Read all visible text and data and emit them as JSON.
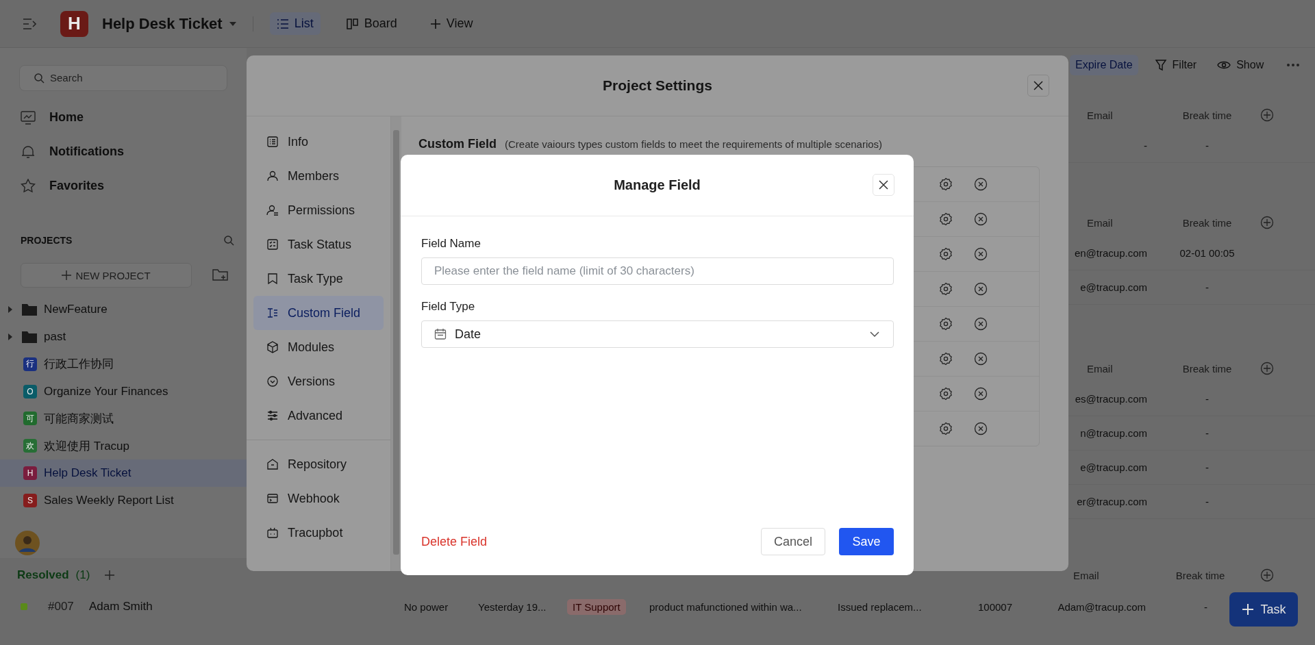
{
  "topbar": {
    "logo_letter": "H",
    "project_title": "Help Desk Ticket",
    "views": [
      {
        "label": "List",
        "selected": true
      },
      {
        "label": "Board",
        "selected": false
      }
    ],
    "add_view": "View"
  },
  "sidebar": {
    "search_placeholder": "Search",
    "nav": [
      "Home",
      "Notifications",
      "Favorites"
    ],
    "projects_heading": "PROJECTS",
    "new_project": "NEW PROJECT",
    "projects": [
      {
        "kind": "folder",
        "name": "NewFeature",
        "selected": false
      },
      {
        "kind": "folder",
        "name": "past",
        "selected": false
      },
      {
        "kind": "project",
        "letter": "行",
        "color": "#1a3080",
        "name": "行政工作协同",
        "selected": false
      },
      {
        "kind": "project",
        "letter": "O",
        "color": "#0a5c68",
        "name": "Organize Your Finances",
        "selected": false
      },
      {
        "kind": "project",
        "letter": "可",
        "color": "#216b2e",
        "name": "可能商家测试",
        "selected": false
      },
      {
        "kind": "project",
        "letter": "欢",
        "color": "#276e35",
        "name": "欢迎使用 Tracup",
        "selected": false
      },
      {
        "kind": "project",
        "letter": "H",
        "color": "#7a1d3e",
        "name": "Help Desk Ticket",
        "selected": true
      },
      {
        "kind": "project",
        "letter": "S",
        "color": "#861d1d",
        "name": "Sales Weekly Report List",
        "selected": false
      }
    ]
  },
  "toolbar": {
    "sort": "Expire Date",
    "filter": "Filter",
    "show": "Show"
  },
  "groups": [
    {
      "columns": [
        "Email",
        "Break time"
      ],
      "rows": [
        {
          "email": "-",
          "break_time": "-"
        }
      ]
    },
    {
      "columns": [
        "Email",
        "Break time"
      ],
      "rows": [
        {
          "email": "en@tracup.com",
          "break_time": "02-01 00:05"
        },
        {
          "email": "e@tracup.com",
          "break_time": "-"
        }
      ]
    },
    {
      "columns": [
        "Email",
        "Break time"
      ],
      "rows": [
        {
          "email": "es@tracup.com",
          "break_time": "-"
        },
        {
          "email": "n@tracup.com",
          "break_time": "-"
        },
        {
          "email": "e@tracup.com",
          "break_time": "-"
        },
        {
          "email": "er@tracup.com",
          "break_time": "-"
        }
      ]
    }
  ],
  "resolved": {
    "name": "Resolved",
    "count": "(1)",
    "columns": [
      "Email",
      "Break time"
    ],
    "row": {
      "color": "#5a8a1a",
      "id": "#007",
      "name": "Adam Smith",
      "problem": "No power",
      "time": "Yesterday 19...",
      "tag": "IT Support",
      "description": "product mafunctioned within wa...",
      "resolution": "Issued replacem...",
      "ticket": "100007",
      "email": "Adam@tracup.com",
      "break_time": "-"
    }
  },
  "add_task": "Task",
  "settings": {
    "title": "Project Settings",
    "nav": [
      {
        "kind": "info",
        "label": "Info",
        "selected": false
      },
      {
        "kind": "members",
        "label": "Members",
        "selected": false
      },
      {
        "kind": "permissions",
        "label": "Permissions",
        "selected": false
      },
      {
        "kind": "status",
        "label": "Task Status",
        "selected": false
      },
      {
        "kind": "type",
        "label": "Task Type",
        "selected": false
      },
      {
        "kind": "custom",
        "label": "Custom Field",
        "selected": true
      },
      {
        "kind": "modules",
        "label": "Modules",
        "selected": false
      },
      {
        "kind": "versions",
        "label": "Versions",
        "selected": false
      },
      {
        "kind": "advanced",
        "label": "Advanced",
        "selected": false
      }
    ],
    "integrations": [
      {
        "kind": "repository",
        "label": "Repository",
        "selected": false
      },
      {
        "kind": "webhook",
        "label": "Webhook",
        "selected": false
      },
      {
        "kind": "bot",
        "label": "Tracupbot",
        "selected": false
      }
    ],
    "section_title": "Custom Field",
    "section_hint": "(Create vaiours types custom fields to meet the requirements of multiple scenarios)"
  },
  "manage_field": {
    "title": "Manage Field",
    "name_label": "Field Name",
    "name_placeholder": "Please enter the field name (limit of 30 characters)",
    "type_label": "Field Type",
    "type_value": "Date",
    "delete": "Delete Field",
    "cancel": "Cancel",
    "save": "Save"
  }
}
